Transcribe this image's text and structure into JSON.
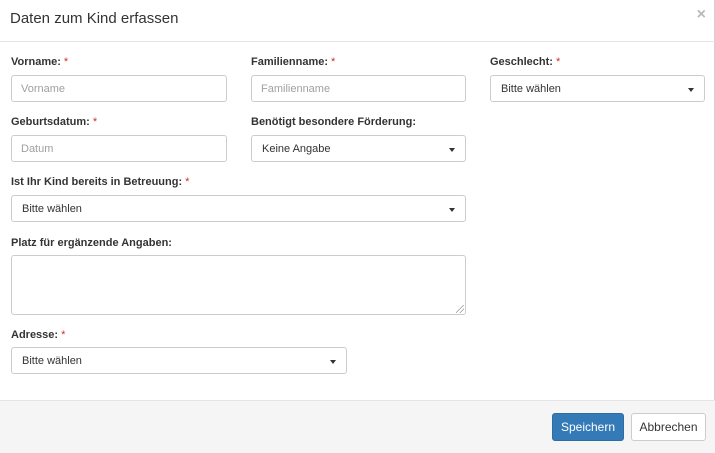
{
  "modal": {
    "title": "Daten zum Kind erfassen",
    "close_symbol": "×"
  },
  "form": {
    "required_marker": "*",
    "first_name": {
      "label": "Vorname:",
      "placeholder": "Vorname",
      "value": ""
    },
    "last_name": {
      "label": "Familienname:",
      "placeholder": "Familienname",
      "value": ""
    },
    "gender": {
      "label": "Geschlecht:",
      "selected": "Bitte wählen"
    },
    "birth_date": {
      "label": "Geburtsdatum:",
      "placeholder": "Datum",
      "value": ""
    },
    "special_support": {
      "label": "Benötigt besondere Förderung:",
      "selected": "Keine Angabe"
    },
    "in_care": {
      "label": "Ist Ihr Kind bereits in Betreuung:",
      "selected": "Bitte wählen"
    },
    "additional_info": {
      "label": "Platz für ergänzende Angaben:",
      "value": ""
    },
    "address": {
      "label": "Adresse:",
      "selected": "Bitte wählen"
    }
  },
  "footer": {
    "save_label": "Speichern",
    "cancel_label": "Abbrechen"
  },
  "colors": {
    "primary": "#337ab7",
    "required": "#c9302c",
    "footer_bg": "#f5f5f5"
  },
  "icons": {
    "close": "close-icon",
    "dropdown": "caret-down-icon",
    "resize": "resize-grip-icon"
  }
}
